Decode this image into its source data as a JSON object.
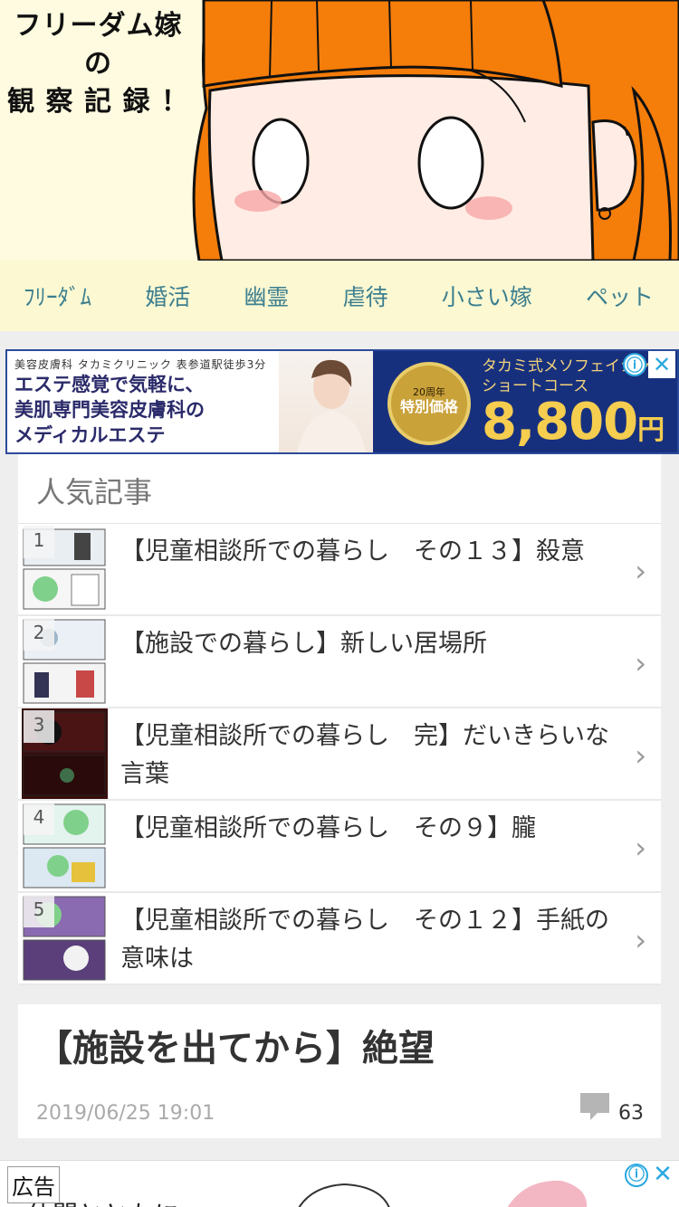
{
  "header": {
    "title_lines": [
      "フリーダム嫁",
      "の",
      "観 察 記 録 ！"
    ]
  },
  "nav": {
    "items": [
      "ﾌﾘｰﾀﾞﾑ",
      "婚活",
      "幽霊",
      "虐待",
      "小さい嫁",
      "ペット"
    ]
  },
  "ad_top": {
    "clinic": "美容皮膚科 タカミクリニック 表参道駅徒歩3分",
    "copy_lines": [
      "エステ感覚で気軽に、",
      "美肌専門美容皮膚科の",
      "メディカルエステ"
    ],
    "badge_top": "20周年",
    "badge_main": "特別価格",
    "course": "タカミ式メソフェイシャル",
    "course2": "ショートコース",
    "price": "8,800",
    "yen": "円",
    "info_icon": "ⓘ",
    "close_icon": "✕"
  },
  "popular": {
    "title": "人気記事",
    "items": [
      {
        "rank": "1",
        "title": "【児童相談所での暮らし　その１３】殺意"
      },
      {
        "rank": "2",
        "title": "【施設での暮らし】新しい居場所"
      },
      {
        "rank": "3",
        "title": "【児童相談所での暮らし　完】だいきらいな言葉"
      },
      {
        "rank": "4",
        "title": "【児童相談所での暮らし　その９】朧"
      },
      {
        "rank": "5",
        "title": "【児童相談所での暮らし　その１２】手紙の意味は"
      }
    ],
    "chevron": "›"
  },
  "article": {
    "title": "【施設を出てから】絶望",
    "date": "2019/06/25 19:01",
    "comments": "63"
  },
  "ad_bottom": {
    "label": "広告",
    "text": "仲間とともに",
    "info_icon": "ⓘ",
    "close_icon": "✕"
  },
  "colors": {
    "hair": "#f57d0a",
    "nav_text": "#3d7f8f",
    "header_bg": "#fffbe0",
    "nav_bg": "#fbf8d2",
    "ad_blue": "#17307e",
    "ad_gold": "#f5cd4f"
  }
}
